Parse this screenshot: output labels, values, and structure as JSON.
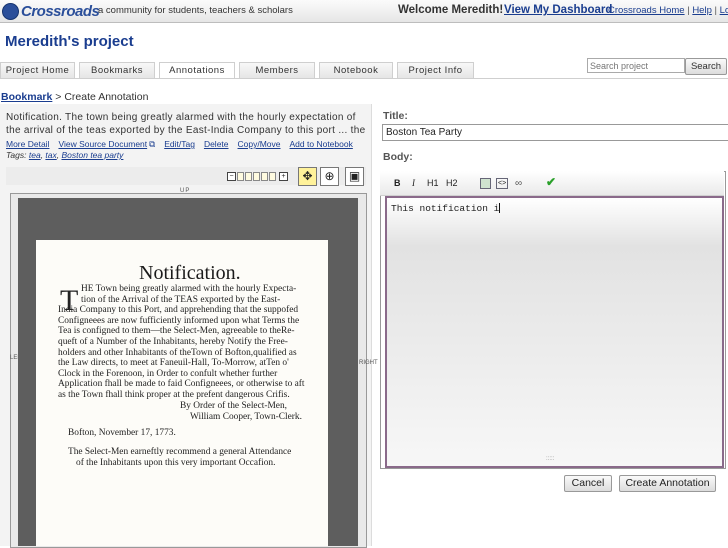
{
  "header": {
    "logo_text": "Crossroads",
    "tagline": "a community for students, teachers & scholars",
    "welcome": "Welcome Meredith!",
    "dashboard_link": "View My Dashboard",
    "links": [
      "Crossroads Home",
      "Help",
      "Logo"
    ],
    "separator": "|"
  },
  "project": {
    "title": "Meredith's project",
    "search_placeholder": "Search project",
    "search_button": "Search",
    "tabs": [
      "Project Home",
      "Bookmarks",
      "Annotations",
      "Members",
      "Notebook",
      "Project Info"
    ],
    "active_tab": "Annotations"
  },
  "breadcrumb": {
    "link": "Bookmark",
    "sep": ">",
    "current": "Create Annotation"
  },
  "source": {
    "line1": "Notification. The town being greatly alarmed with the hourly expectation of",
    "line2": "the arrival of the teas exported by the East-India Company to this port ... the",
    "actions": [
      "More Detail",
      "View Source Document",
      "Edit/Tag",
      "Delete",
      "Copy/Move",
      "Add to Notebook"
    ],
    "tags_label": "Tags:",
    "tags": [
      "tea",
      "tax",
      "Boston tea party"
    ]
  },
  "viewer": {
    "up_label": "UP",
    "left_label": "LEFT",
    "right_label": "RIGHT",
    "zoom_minus": "−",
    "zoom_plus": "+"
  },
  "document": {
    "title": "Notification.",
    "dropcap": "T",
    "lines": [
      "HE Town being greatly alarmed with the hourly Expecta-",
      "tion of the Arrival of the TEAS exported by the East-",
      "India Company to this Port, and apprehending that the suppofed",
      "Configneees are now fufficiently informed upon what Terms the",
      "Tea is configned to them—the Select-Men, agreeable to theRe-",
      "queft of a Number of the Inhabitants, hereby Notify the Free-",
      "holders and other Inhabitants of theTown of Bofton,qualified as",
      "the Law directs, to meet at Faneuil-Hall, To-Morrow, atTen o'",
      "Clock in the Forenoon, in Order to confult whether further",
      "Application fhall be made to faid Configneees, or otherwise to aft",
      "as the Town fhall think proper at the prefent dangerous Crifis.",
      "By Order of the Select-Men,",
      "William Cooper, Town-Clerk.",
      "Bofton, November 17, 1773.",
      "The Select-Men earneftly recommend a general Attendance",
      "of the Inhabitants upon this very important Occafion."
    ]
  },
  "form": {
    "title_label": "Title:",
    "title_value": "Boston Tea Party",
    "body_label": "Body:",
    "toolbar": [
      "B",
      "I",
      "H1",
      "H2"
    ],
    "body_text": "This notification i",
    "cancel_button": "Cancel",
    "create_button": "Create Annotation"
  },
  "colors": {
    "link": "#1a3d8f",
    "editor_border": "#8a6a8a",
    "tool_selected": "#fff29a"
  }
}
